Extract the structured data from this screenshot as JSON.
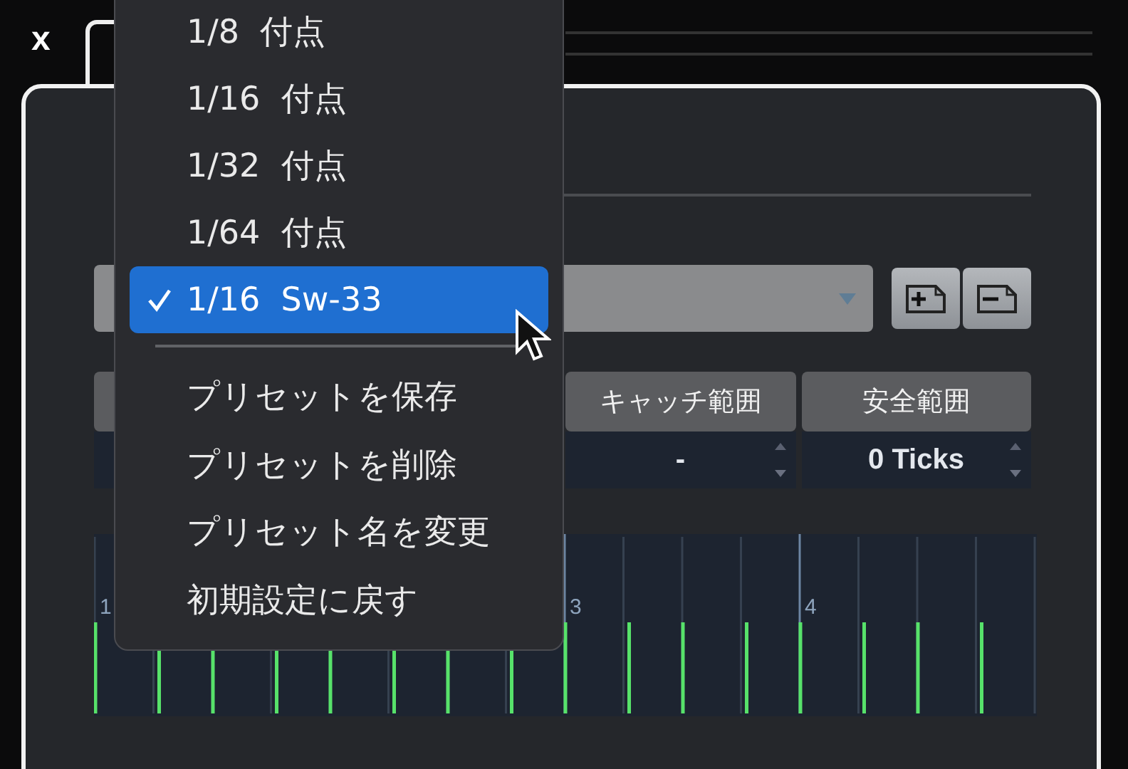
{
  "close_tab": {
    "label": "x"
  },
  "menu": {
    "items": [
      {
        "kind": "option",
        "label": "1/8  付点",
        "selected": false
      },
      {
        "kind": "option",
        "label": "1/16  付点",
        "selected": false
      },
      {
        "kind": "option",
        "label": "1/32  付点",
        "selected": false
      },
      {
        "kind": "option",
        "label": "1/64  付点",
        "selected": false
      },
      {
        "kind": "option",
        "label": "1/16  Sw-33",
        "selected": true
      },
      {
        "kind": "separator"
      },
      {
        "kind": "action",
        "label": "プリセットを保存"
      },
      {
        "kind": "action",
        "label": "プリセットを削除"
      },
      {
        "kind": "action",
        "label": "プリセット名を変更"
      },
      {
        "kind": "action",
        "label": "初期設定に戻す"
      }
    ]
  },
  "columns": [
    {
      "header": "キャッチ範囲",
      "value": "-"
    },
    {
      "header": "安全範囲",
      "value": "0 Ticks"
    }
  ],
  "grid": {
    "bars": [
      "1",
      "3",
      "4"
    ]
  }
}
